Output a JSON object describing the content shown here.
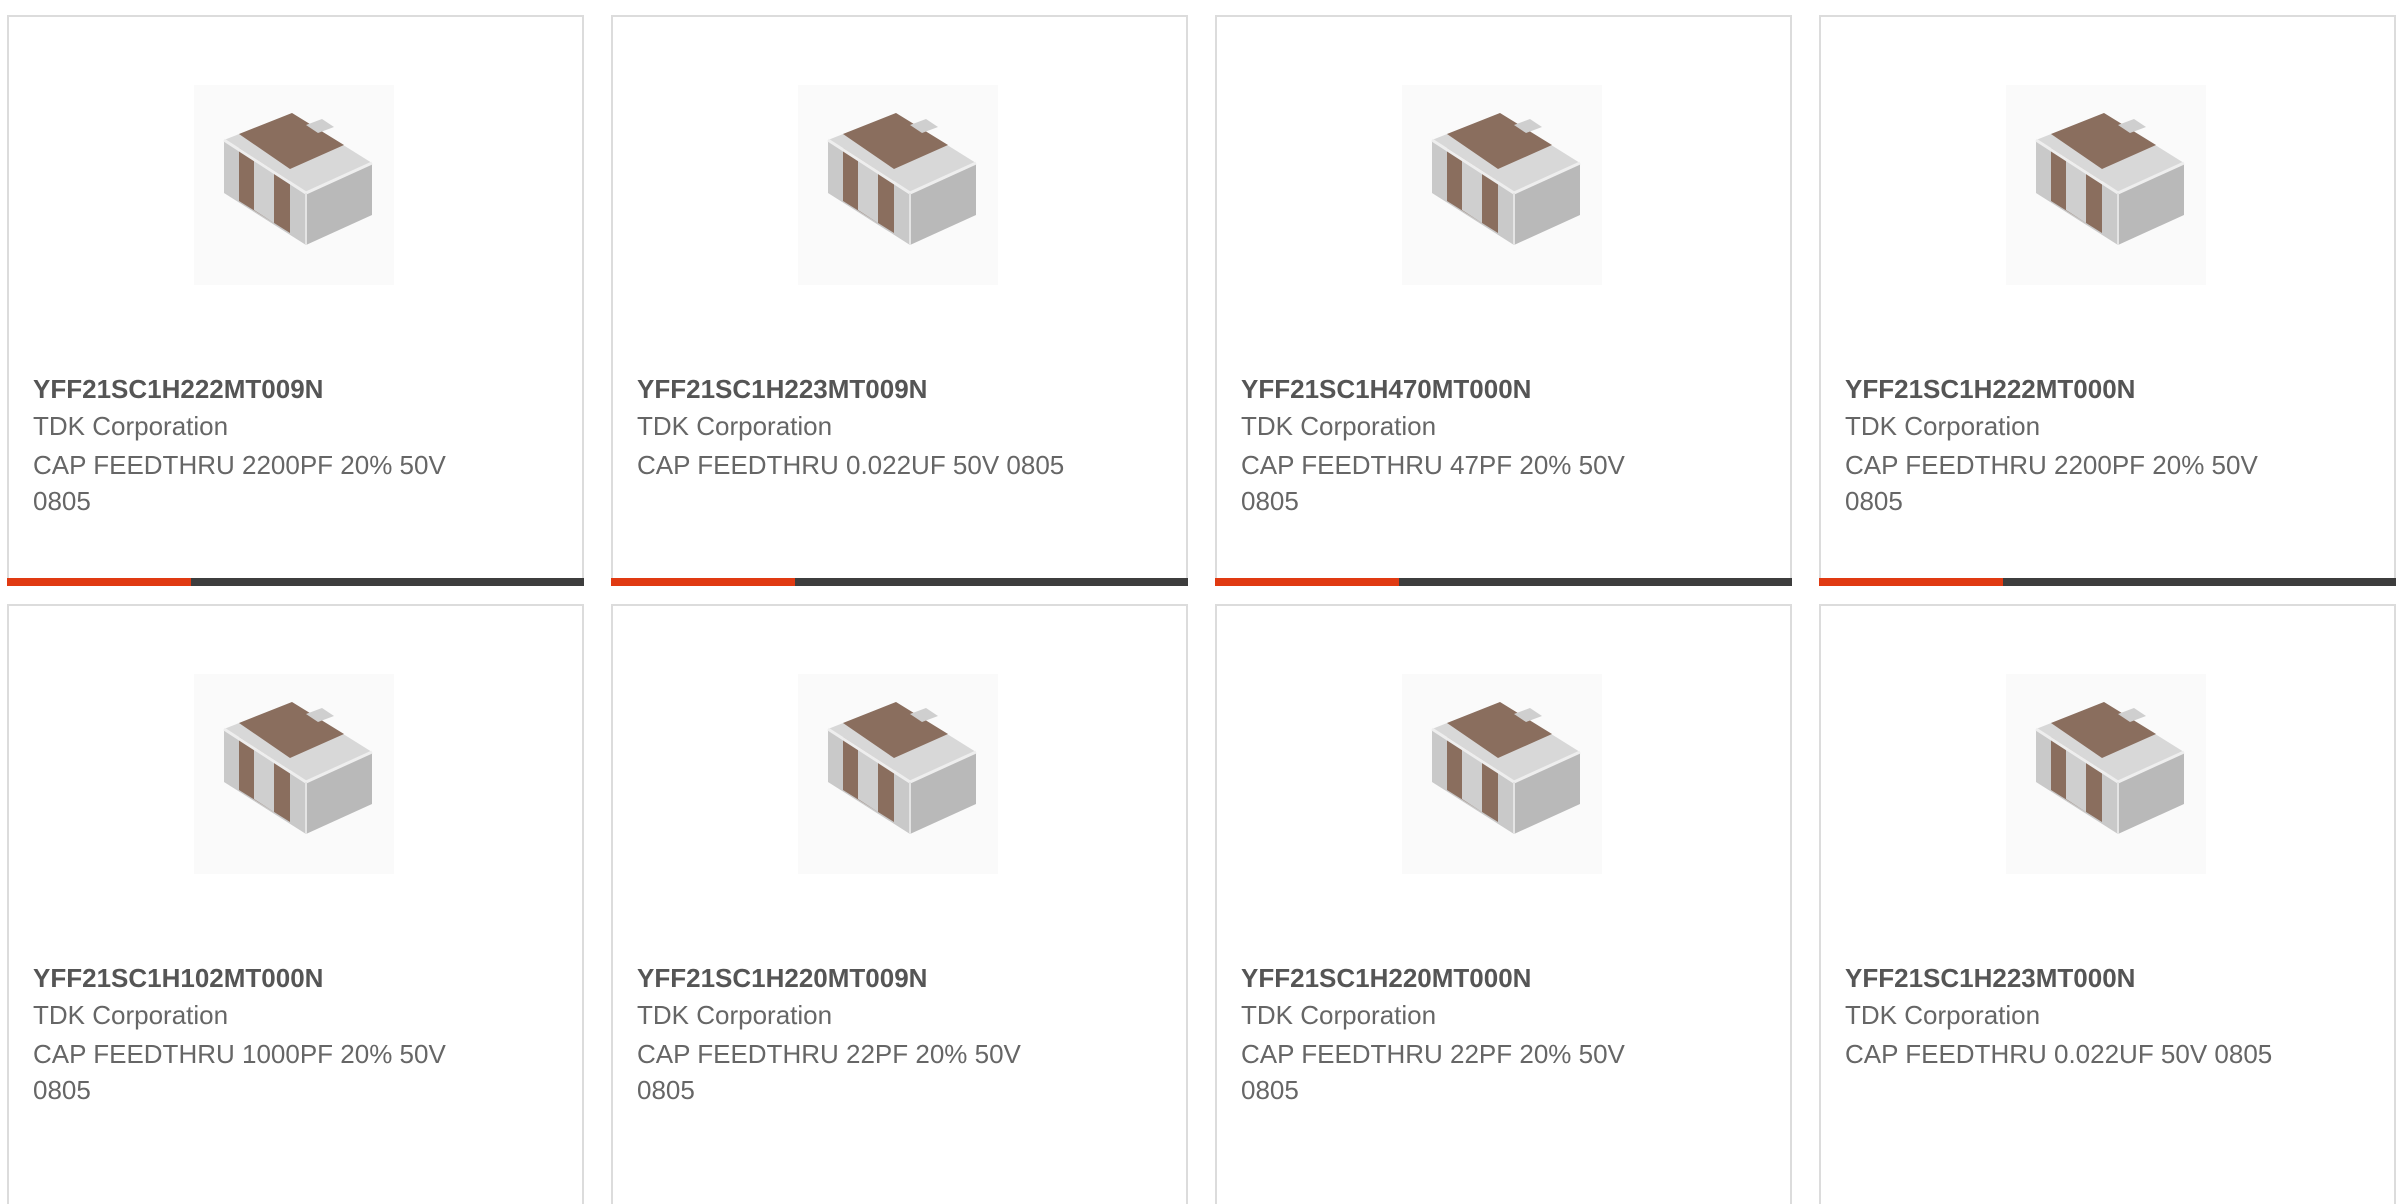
{
  "colors": {
    "accent": "#e03a12",
    "bar_dark": "#3d3d3d",
    "card_border": "#dcdcdc",
    "body_brown": "#8a6e5e",
    "terminal_grey": "#c8c8c8"
  },
  "products": [
    {
      "part_number": "YFF21SC1H222MT009N",
      "manufacturer": "TDK Corporation",
      "description": "CAP FEEDTHRU 2200PF 20% 50V 0805",
      "image_icon": "smd-capacitor-image"
    },
    {
      "part_number": "YFF21SC1H223MT009N",
      "manufacturer": "TDK Corporation",
      "description": "CAP FEEDTHRU 0.022UF 50V 0805",
      "image_icon": "smd-capacitor-image"
    },
    {
      "part_number": "YFF21SC1H470MT000N",
      "manufacturer": "TDK Corporation",
      "description": "CAP FEEDTHRU 47PF 20% 50V 0805",
      "image_icon": "smd-capacitor-image"
    },
    {
      "part_number": "YFF21SC1H222MT000N",
      "manufacturer": "TDK Corporation",
      "description": "CAP FEEDTHRU 2200PF 20% 50V 0805",
      "image_icon": "smd-capacitor-image"
    },
    {
      "part_number": "YFF21SC1H102MT000N",
      "manufacturer": "TDK Corporation",
      "description": "CAP FEEDTHRU 1000PF 20% 50V 0805",
      "image_icon": "smd-capacitor-image"
    },
    {
      "part_number": "YFF21SC1H220MT009N",
      "manufacturer": "TDK Corporation",
      "description": "CAP FEEDTHRU 22PF 20% 50V 0805",
      "image_icon": "smd-capacitor-image"
    },
    {
      "part_number": "YFF21SC1H220MT000N",
      "manufacturer": "TDK Corporation",
      "description": "CAP FEEDTHRU 22PF 20% 50V 0805",
      "image_icon": "smd-capacitor-image"
    },
    {
      "part_number": "YFF21SC1H223MT000N",
      "manufacturer": "TDK Corporation",
      "description": "CAP FEEDTHRU 0.022UF 50V 0805",
      "image_icon": "smd-capacitor-image"
    }
  ]
}
